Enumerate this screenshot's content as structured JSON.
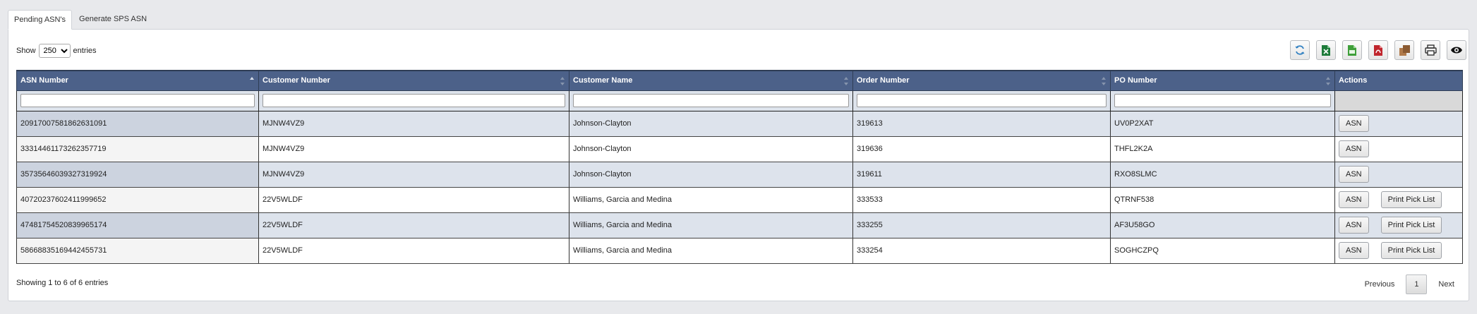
{
  "tabs": [
    {
      "label": "Pending ASN's"
    },
    {
      "label": "Generate SPS ASN"
    }
  ],
  "length_control": {
    "show_label": "Show",
    "value": "250",
    "entries_label": "entries"
  },
  "toolbar": {
    "buttons": [
      {
        "icon": "refresh-icon",
        "color": "#2f7fc1"
      },
      {
        "icon": "excel-icon",
        "color": "#1e7b3a"
      },
      {
        "icon": "csv-icon",
        "color": "#3f9f3a"
      },
      {
        "icon": "pdf-icon",
        "color": "#c0262e"
      },
      {
        "icon": "copy-icon",
        "color": "#8a5a32"
      },
      {
        "icon": "print-icon",
        "color": "#333333"
      },
      {
        "icon": "eye-icon",
        "color": "#111111"
      }
    ]
  },
  "table": {
    "columns": [
      "ASN Number",
      "Customer Number",
      "Customer Name",
      "Order Number",
      "PO Number",
      "Actions"
    ],
    "rows": [
      {
        "asn": "20917007581862631091",
        "customer_number": "MJNW4VZ9",
        "customer_name": "Johnson-Clayton",
        "order": "319613",
        "po": "UV0P2XAT",
        "asn_btn": "ASN"
      },
      {
        "asn": "33314461173262357719",
        "customer_number": "MJNW4VZ9",
        "customer_name": "Johnson-Clayton",
        "order": "319636",
        "po": "THFL2K2A",
        "asn_btn": "ASN"
      },
      {
        "asn": "35735646039327319924",
        "customer_number": "MJNW4VZ9",
        "customer_name": "Johnson-Clayton",
        "order": "319611",
        "po": "RXO8SLMC",
        "asn_btn": "ASN"
      },
      {
        "asn": "40720237602411999652",
        "customer_number": "22V5WLDF",
        "customer_name": "Williams, Garcia and Medina",
        "order": "333533",
        "po": "QTRNF538",
        "asn_btn": "ASN",
        "pick_btn": "Print Pick List"
      },
      {
        "asn": "47481754520839965174",
        "customer_number": "22V5WLDF",
        "customer_name": "Williams, Garcia and Medina",
        "order": "333255",
        "po": "AF3U58GO",
        "asn_btn": "ASN",
        "pick_btn": "Print Pick List"
      },
      {
        "asn": "58668835169442455731",
        "customer_number": "22V5WLDF",
        "customer_name": "Williams, Garcia and Medina",
        "order": "333254",
        "po": "SOGHCZPQ",
        "asn_btn": "ASN",
        "pick_btn": "Print Pick List"
      }
    ]
  },
  "footer": {
    "info": "Showing 1 to 6 of 6 entries",
    "previous": "Previous",
    "page": "1",
    "next": "Next"
  }
}
